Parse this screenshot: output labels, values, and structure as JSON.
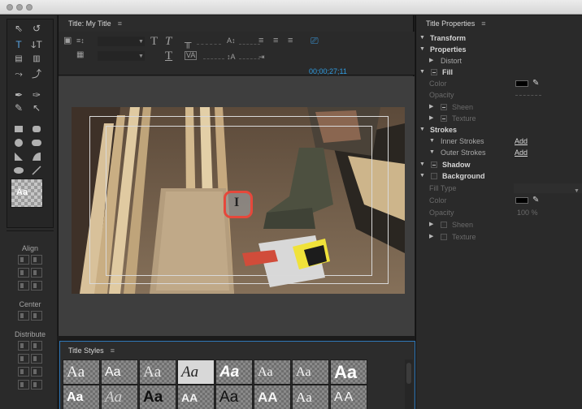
{
  "window": {
    "controls": [
      "close",
      "minimize",
      "zoom"
    ]
  },
  "tools": {
    "items": [
      "selection-tool",
      "rotation-tool",
      "type-tool",
      "vertical-type-tool",
      "area-type-tool",
      "vertical-area-type-tool",
      "path-type-tool",
      "vertical-path-type-tool",
      "pen-tool",
      "delete-anchor-point-tool",
      "add-anchor-point-tool",
      "convert-anchor-point-tool",
      "rectangle-tool",
      "rounded-rectangle-tool",
      "ellipse-tool",
      "rounded-corner-tool",
      "wedge-tool",
      "arc-tool",
      "ellipse-shape-tool",
      "line-tool"
    ],
    "swatch_label": "Aa"
  },
  "align": {
    "label": "Align",
    "center_label": "Center",
    "distribute_label": "Distribute"
  },
  "title_panel": {
    "label": "Title: My Title",
    "menu_icon": "panel-menu-icon"
  },
  "toolbar": {
    "timecode": "00;00;27;11",
    "type_label": "T"
  },
  "title_styles": {
    "label": "Title Styles",
    "menu_icon": "panel-menu-icon",
    "row1": [
      "Aa",
      "Aa",
      "Aa",
      "Aa",
      "Aa",
      "Aa",
      "Aa",
      "Aa"
    ],
    "row2": [
      "Aa",
      "Aa",
      "Aa",
      "AA",
      "Aa",
      "AA",
      "Aa",
      "AA"
    ]
  },
  "cursor": {
    "text_cursor_glyph": "I"
  },
  "title_properties": {
    "label": "Title Properties",
    "menu_icon": "panel-menu-icon",
    "transform": "Transform",
    "properties": "Properties",
    "distort": "Distort",
    "fill": "Fill",
    "color": "Color",
    "opacity": "Opacity",
    "sheen": "Sheen",
    "texture": "Texture",
    "strokes": "Strokes",
    "inner_strokes": "Inner Strokes",
    "outer_strokes": "Outer Strokes",
    "add": "Add",
    "shadow": "Shadow",
    "background": "Background",
    "fill_type": "Fill Type",
    "bg_color": "Color",
    "bg_opacity": "Opacity",
    "bg_opacity_value": "100 %",
    "bg_sheen": "Sheen",
    "bg_texture": "Texture",
    "fill_color_hex": "#000000"
  }
}
